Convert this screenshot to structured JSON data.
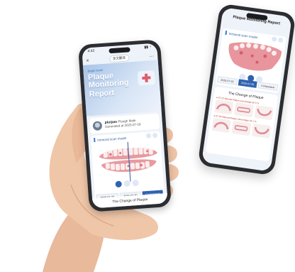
{
  "phone_left": {
    "status_time": "4:42",
    "close_label": "×",
    "topbar_pill": "全文翻译",
    "hero_tag": "Bright Smile",
    "hero_title_line1": "Plaque Monitoring",
    "hero_title_line2": "Report",
    "patient_name": "plu/pas",
    "patient_meta1": "Plough",
    "patient_meta2": "Male",
    "patient_generated": "Generated at 2025-07-29",
    "card_title": "Intraoral scan model",
    "date_left": "2025-07-20",
    "date_right": "2025-07-30",
    "compare_label": "Comparison",
    "footer_text": "The Change of Plaque"
  },
  "phone_right": {
    "header_title": "Plaque Monitoring Report",
    "card_title": "Intraoral scan model",
    "date_left": "2025-07-22",
    "date_mid": "2025-07-29",
    "compare_label": "Comparison",
    "change_title": "The Change of Plaque",
    "row1_label": "● 07-22 Manual Plaque percentage 56.3 %",
    "row2_label": "● 07-29 Manual Plaque percentage 43.1 %"
  },
  "colors": {
    "accent": "#2f62b0",
    "hero_start": "#a9c4e8",
    "plaque": "#e8737e",
    "gum": "#e89a9a"
  }
}
